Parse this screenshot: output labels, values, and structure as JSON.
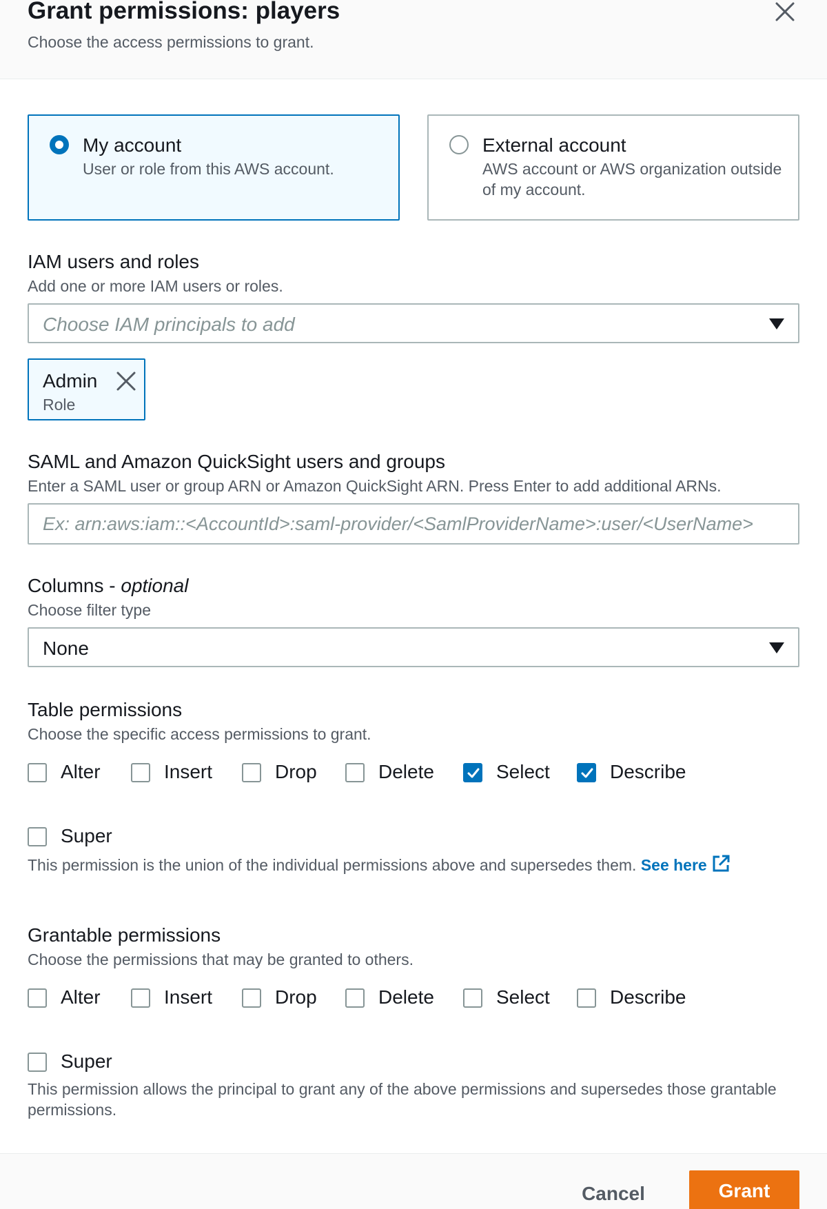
{
  "dialog": {
    "title": "Grant permissions: players",
    "subtitle": "Choose the access permissions to grant."
  },
  "account_tiles": {
    "my_account": {
      "title": "My account",
      "description": "User or role from this AWS account.",
      "selected": true
    },
    "external_account": {
      "title": "External account",
      "description": "AWS account or AWS organization outside of my account.",
      "selected": false
    }
  },
  "iam": {
    "label": "IAM users and roles",
    "description": "Add one or more IAM users or roles.",
    "placeholder": "Choose IAM principals to add",
    "token": {
      "name": "Admin",
      "type": "Role"
    }
  },
  "saml": {
    "label": "SAML and Amazon QuickSight users and groups",
    "description": "Enter a SAML user or group ARN or Amazon QuickSight ARN. Press Enter to add additional ARNs.",
    "placeholder": "Ex: arn:aws:iam::<AccountId>:saml-provider/<SamlProviderName>:user/<UserName>",
    "value": ""
  },
  "columns": {
    "label": "Columns - ",
    "label_optional": "optional",
    "description": "Choose filter type",
    "selected": "None"
  },
  "table_permissions": {
    "label": "Table permissions",
    "description": "Choose the specific access permissions to grant.",
    "options": [
      {
        "label": "Alter",
        "checked": false
      },
      {
        "label": "Insert",
        "checked": false
      },
      {
        "label": "Drop",
        "checked": false
      },
      {
        "label": "Delete",
        "checked": false
      },
      {
        "label": "Select",
        "checked": true
      },
      {
        "label": "Describe",
        "checked": true
      }
    ],
    "super": {
      "label": "Super",
      "checked": false
    },
    "super_help": "This permission is the union of the individual permissions above and supersedes them. ",
    "super_link": "See here"
  },
  "grantable_permissions": {
    "label": "Grantable permissions",
    "description": "Choose the permissions that may be granted to others.",
    "options": [
      {
        "label": "Alter",
        "checked": false
      },
      {
        "label": "Insert",
        "checked": false
      },
      {
        "label": "Drop",
        "checked": false
      },
      {
        "label": "Delete",
        "checked": false
      },
      {
        "label": "Select",
        "checked": false
      },
      {
        "label": "Describe",
        "checked": false
      }
    ],
    "super": {
      "label": "Super",
      "checked": false
    },
    "super_help": "This permission allows the principal to grant any of the above permissions and supersedes those grantable permissions."
  },
  "footer": {
    "cancel_label": "Cancel",
    "grant_label": "Grant"
  },
  "icons": {
    "close": "close-icon",
    "dismiss": "close-icon",
    "dropdown": "caret-down-icon",
    "checkmark": "checkmark-icon",
    "external_link": "external-link-icon"
  },
  "colors": {
    "accent": "#0073bb",
    "primary_button": "#ec7211",
    "selected_tile_bg": "#f1faff"
  }
}
